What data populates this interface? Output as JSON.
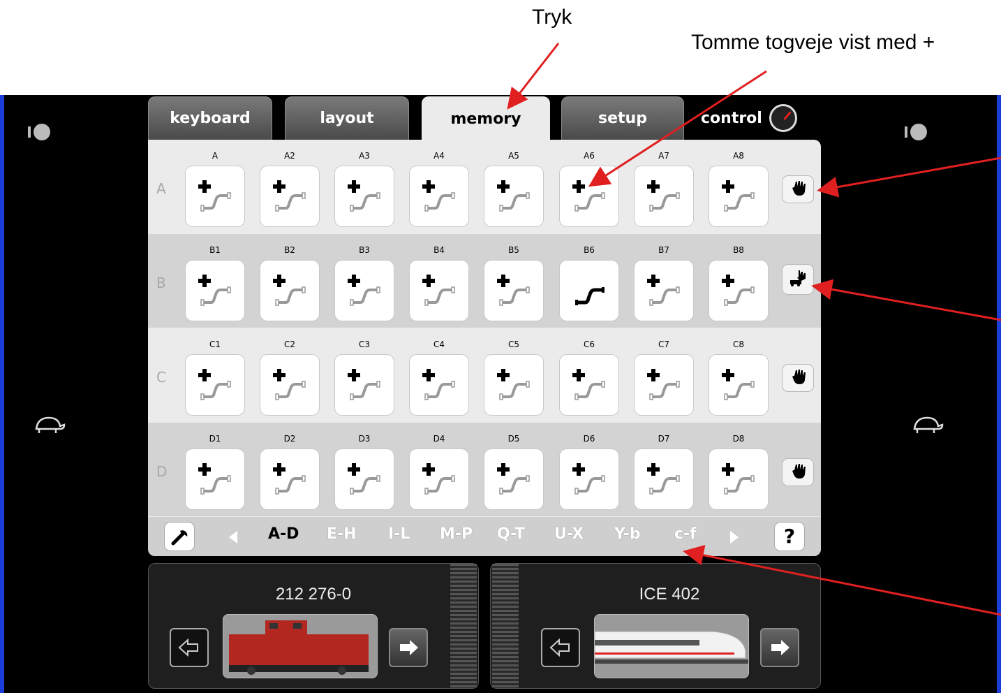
{
  "annotations": {
    "press": "Tryk",
    "empty_routes": "Tomme togveje vist med +"
  },
  "tabs": {
    "keyboard": "keyboard",
    "layout": "layout",
    "memory": "memory",
    "setup": "setup",
    "control": "control",
    "active": "memory"
  },
  "rows": [
    {
      "letter": "A",
      "cells": [
        "A",
        "A2",
        "A3",
        "A4",
        "A5",
        "A6",
        "A7",
        "A8"
      ]
    },
    {
      "letter": "B",
      "cells": [
        "B1",
        "B2",
        "B3",
        "B4",
        "B5",
        "B6",
        "B7",
        "B8"
      ]
    },
    {
      "letter": "C",
      "cells": [
        "C1",
        "C2",
        "C3",
        "C4",
        "C5",
        "C6",
        "C7",
        "C8"
      ]
    },
    {
      "letter": "D",
      "cells": [
        "D1",
        "D2",
        "D3",
        "D4",
        "D5",
        "D6",
        "D7",
        "D8"
      ]
    }
  ],
  "configured_cell": "B6",
  "row_buttons": [
    "hand-icon",
    "hand-locomotive-icon",
    "hand-icon",
    "hand-icon"
  ],
  "pages": [
    "A-D",
    "E-H",
    "I-L",
    "M-P",
    "Q-T",
    "U-X",
    "Y-b",
    "c-f"
  ],
  "active_page": "A-D",
  "bottom_bar": {
    "settings_icon": "wrench-icon",
    "help": "?"
  },
  "locos": {
    "left": {
      "name": "212 276-0",
      "image": "red-diesel-locomotive"
    },
    "right": {
      "name": "ICE 402",
      "image": "ice-high-speed-train"
    }
  },
  "side_icons": [
    "rabbit-icon",
    "turtle-icon"
  ],
  "colors": {
    "annotation_arrow": "#e02020",
    "screen_border": "#1a3fd8"
  }
}
